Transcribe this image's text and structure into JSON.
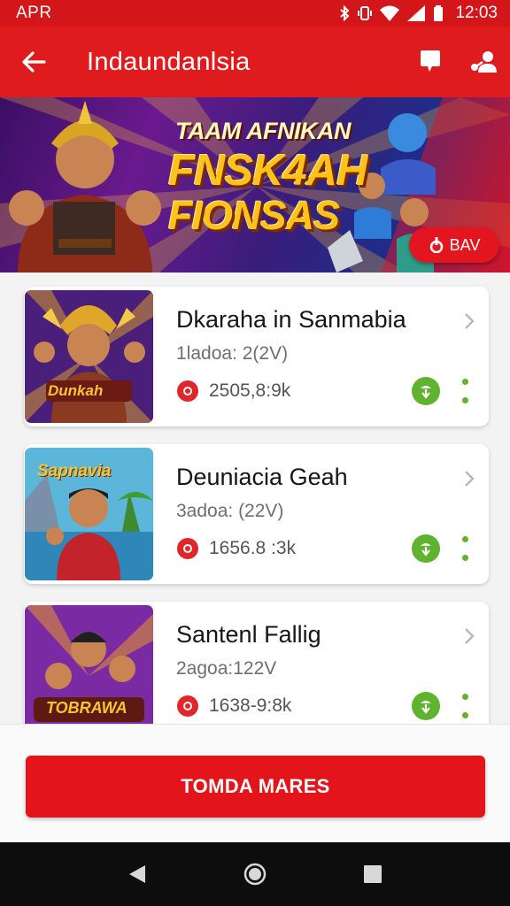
{
  "status_bar": {
    "carrier": "APR",
    "time": "12:03"
  },
  "app_bar": {
    "title": "Indaundanlsia",
    "back_icon": "arrow-left-icon",
    "actions": [
      "chat-bubble-icon",
      "share-people-icon"
    ]
  },
  "banner": {
    "kicker": "TAAM AFNIKAN",
    "headline_line1": "FNSK4AH",
    "headline_line2": "FIONSAS",
    "button_label": "BAV"
  },
  "games": [
    {
      "title": "Dkaraha in Sanmabia",
      "subtitle": "1ladoa: 2(2V)",
      "stat": "2505,8:9k",
      "thumb_caption": "Dunkah"
    },
    {
      "title": "Deuniacia Geah",
      "subtitle": "3adoa: (22V)",
      "stat": "1656.8 :3k",
      "thumb_caption": "Sapnavia"
    },
    {
      "title": "Santenl Fallig",
      "subtitle": "2agoa:122V",
      "stat": "1638-9:8k",
      "thumb_caption": "TOBRAWA"
    }
  ],
  "cta": {
    "label": "TOMDA MARES"
  },
  "colors": {
    "primary_red": "#e01b1e",
    "status_red": "#d3161a",
    "action_green": "#5fb32f",
    "banner_purple": "#6a1a8e",
    "nav_black": "#0d0d0d"
  }
}
